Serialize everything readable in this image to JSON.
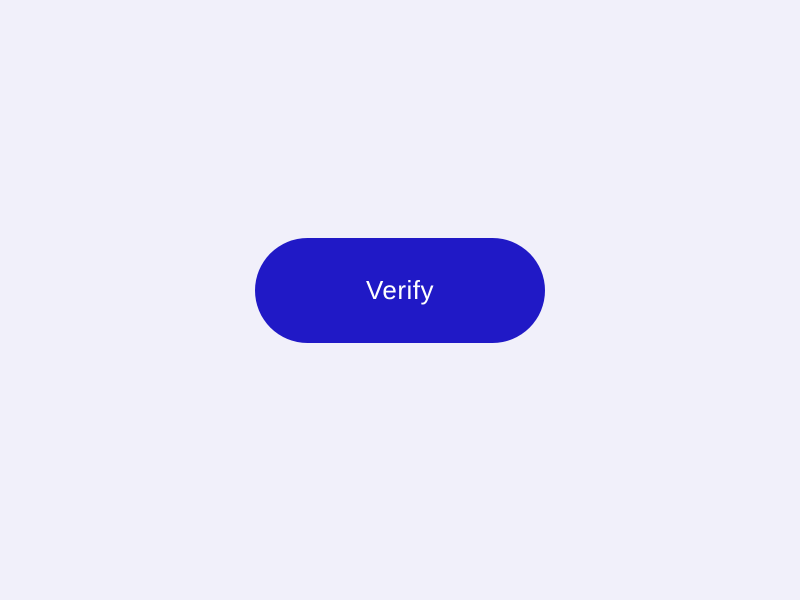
{
  "button": {
    "label": "Verify"
  }
}
